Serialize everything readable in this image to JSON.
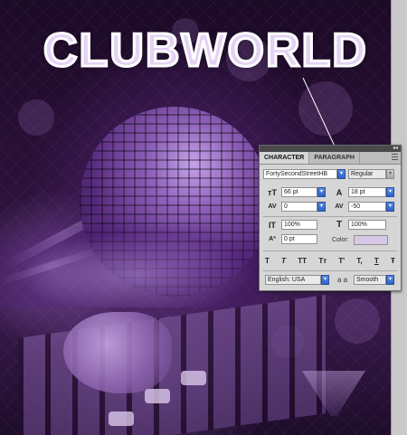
{
  "artwork": {
    "title_text": "CLUBWORLD"
  },
  "panel": {
    "tabs": [
      "CHARACTER",
      "PARAGRAPH"
    ],
    "font_family": "FortySecondStreetHB",
    "font_style": "Regular",
    "font_size": "66 pt",
    "leading": "18 pt",
    "kerning": "0",
    "tracking": "-50",
    "vertical_scale": "100%",
    "horizontal_scale": "100%",
    "baseline_shift": "0 pt",
    "color_label": "Color:",
    "color_value": "#d8c8e6",
    "language": "English: USA",
    "aa_label": "a a",
    "antialias": "Smooth",
    "style_buttons": [
      "T",
      "T",
      "TT",
      "Tт",
      "T'",
      "T,",
      "T",
      "Ŧ"
    ]
  },
  "icons": {
    "collapse": "double-arrow-icon",
    "panel_menu": "panel-menu-icon"
  }
}
